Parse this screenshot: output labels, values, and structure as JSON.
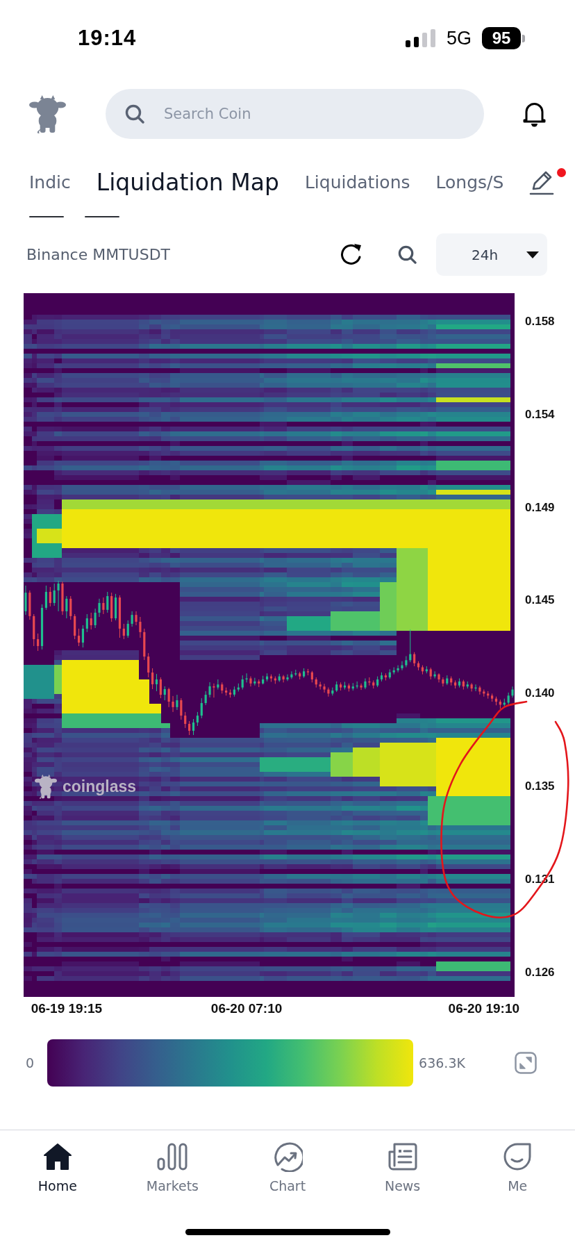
{
  "status_bar": {
    "time": "19:14",
    "network": "5G",
    "battery": "95"
  },
  "search": {
    "placeholder": "Search Coin"
  },
  "tabs": [
    {
      "label": "Indic",
      "selected": false
    },
    {
      "label": "Liquidation Map",
      "selected": true
    },
    {
      "label": "Liquidations",
      "selected": false
    },
    {
      "label": "Longs/S",
      "selected": false
    }
  ],
  "tab_edit": {
    "badge": true
  },
  "toolbar": {
    "pair": "Binance MMTUSDT",
    "interval": "24h"
  },
  "chart": {
    "watermark": "coinglass",
    "chart_data": {
      "type": "candlestick",
      "ylim": [
        0.125,
        0.1598
      ],
      "yticks": [
        {
          "value": 0.1584,
          "label": "0.158"
        },
        {
          "value": 0.1538,
          "label": "0.154"
        },
        {
          "value": 0.1492,
          "label": "0.149"
        },
        {
          "value": 0.1446,
          "label": "0.145"
        },
        {
          "value": 0.14,
          "label": "0.140"
        },
        {
          "value": 0.1354,
          "label": "0.135"
        },
        {
          "value": 0.1308,
          "label": "0.131"
        },
        {
          "value": 0.1262,
          "label": "0.126"
        }
      ],
      "categories": [
        null,
        null,
        null,
        null,
        null,
        null,
        null,
        null,
        null,
        null,
        "06-19 19:15",
        null,
        null,
        null,
        null,
        null,
        null,
        null,
        null,
        null,
        null,
        null,
        null,
        null,
        null,
        null,
        null,
        null,
        null,
        null,
        null,
        null,
        null,
        null,
        null,
        null,
        null,
        null,
        null,
        null,
        null,
        null,
        null,
        null,
        null,
        null,
        null,
        null,
        null,
        null,
        null,
        null,
        null,
        null,
        "06-20 07:10",
        null,
        null,
        null,
        null,
        null,
        null,
        null,
        null,
        null,
        null,
        null,
        null,
        null,
        null,
        null,
        null,
        null,
        null,
        null,
        null,
        null,
        null,
        null,
        null,
        null,
        null,
        null,
        null,
        null,
        null,
        null,
        null,
        null,
        null,
        null,
        null,
        null,
        null,
        null,
        null,
        null,
        null,
        null,
        null,
        null,
        null,
        null,
        null,
        null,
        null,
        null,
        null,
        null,
        null,
        null,
        null,
        null,
        "06-20 19:10",
        null,
        null,
        null,
        null,
        null,
        null,
        null
      ],
      "ohlc": [
        [
          0.14407,
          0.14534,
          0.14389,
          0.14499
        ],
        [
          0.14499,
          0.1451,
          0.14365,
          0.14383
        ],
        [
          0.14383,
          0.14393,
          0.14235,
          0.14269
        ],
        [
          0.14269,
          0.14297,
          0.14211,
          0.14235
        ],
        [
          0.14235,
          0.14441,
          0.14218,
          0.14424
        ],
        [
          0.14424,
          0.14534,
          0.14414,
          0.14503
        ],
        [
          0.14503,
          0.14527,
          0.14431,
          0.14448
        ],
        [
          0.14448,
          0.14544,
          0.14434,
          0.1451
        ],
        [
          0.1451,
          0.14558,
          0.14407,
          0.14544
        ],
        [
          0.14544,
          0.14554,
          0.14389,
          0.14407
        ],
        [
          0.14407,
          0.14482,
          0.14372,
          0.14469
        ],
        [
          0.14469,
          0.14482,
          0.14365,
          0.14383
        ],
        [
          0.14383,
          0.14393,
          0.14269,
          0.14286
        ],
        [
          0.14286,
          0.14321,
          0.14235,
          0.14252
        ],
        [
          0.14252,
          0.14338,
          0.14228,
          0.14321
        ],
        [
          0.14321,
          0.14393,
          0.14304,
          0.14372
        ],
        [
          0.14372,
          0.144,
          0.14317,
          0.14338
        ],
        [
          0.14338,
          0.1442,
          0.14324,
          0.144
        ],
        [
          0.144,
          0.14469,
          0.14379,
          0.14448
        ],
        [
          0.14448,
          0.14475,
          0.14393,
          0.14414
        ],
        [
          0.14414,
          0.14503,
          0.144,
          0.14482
        ],
        [
          0.14482,
          0.14499,
          0.14355,
          0.14372
        ],
        [
          0.14372,
          0.14493,
          0.14362,
          0.14475
        ],
        [
          0.14475,
          0.14486,
          0.14276,
          0.14321
        ],
        [
          0.14321,
          0.14345,
          0.14269,
          0.14286
        ],
        [
          0.14286,
          0.14362,
          0.14276,
          0.14345
        ],
        [
          0.14345,
          0.14407,
          0.14331,
          0.14389
        ],
        [
          0.14389,
          0.14407,
          0.14338,
          0.14355
        ],
        [
          0.14355,
          0.14379,
          0.14276,
          0.14304
        ],
        [
          0.14304,
          0.14321,
          0.14166,
          0.14183
        ],
        [
          0.14183,
          0.142,
          0.1408,
          0.14104
        ],
        [
          0.14104,
          0.14125,
          0.14022,
          0.14046
        ],
        [
          0.14046,
          0.14097,
          0.14012,
          0.1407
        ],
        [
          0.1407,
          0.1408,
          0.13977,
          0.13994
        ],
        [
          0.13994,
          0.14036,
          0.13967,
          0.14022
        ],
        [
          0.14022,
          0.14029,
          0.13933,
          0.1396
        ],
        [
          0.1396,
          0.13988,
          0.13909,
          0.13933
        ],
        [
          0.13933,
          0.13994,
          0.13919,
          0.13967
        ],
        [
          0.13967,
          0.13977,
          0.13871,
          0.13891
        ],
        [
          0.13891,
          0.13909,
          0.1383,
          0.1385
        ],
        [
          0.1385,
          0.13864,
          0.13795,
          0.13816
        ],
        [
          0.13816,
          0.13874,
          0.13795,
          0.13857
        ],
        [
          0.13857,
          0.13909,
          0.1384,
          0.13891
        ],
        [
          0.13891,
          0.13977,
          0.13878,
          0.13953
        ],
        [
          0.13953,
          0.14012,
          0.13943,
          0.13994
        ],
        [
          0.13994,
          0.14056,
          0.13981,
          0.14036
        ],
        [
          0.14036,
          0.1405,
          0.1398,
          0.1403
        ],
        [
          0.1403,
          0.1407,
          0.1402,
          0.14045
        ],
        [
          0.14045,
          0.14055,
          0.14,
          0.14015
        ],
        [
          0.14015,
          0.1403,
          0.1399,
          0.14005
        ],
        [
          0.14005,
          0.1402,
          0.1398,
          0.13995
        ],
        [
          0.13995,
          0.14035,
          0.13985,
          0.1402
        ],
        [
          0.1402,
          0.1405,
          0.1401,
          0.1403
        ],
        [
          0.1403,
          0.1409,
          0.1402,
          0.1407
        ],
        [
          0.1407,
          0.141,
          0.14055,
          0.14075
        ],
        [
          0.14075,
          0.14085,
          0.14035,
          0.1405
        ],
        [
          0.1405,
          0.14078,
          0.1404,
          0.1406
        ],
        [
          0.1406,
          0.1407,
          0.14032,
          0.1405
        ],
        [
          0.1405,
          0.14088,
          0.14045,
          0.1407
        ],
        [
          0.1407,
          0.141,
          0.1406,
          0.14085
        ],
        [
          0.14085,
          0.14095,
          0.14058,
          0.14075
        ],
        [
          0.14075,
          0.14085,
          0.14048,
          0.14065
        ],
        [
          0.14065,
          0.14098,
          0.14058,
          0.14085
        ],
        [
          0.14085,
          0.14092,
          0.14055,
          0.1407
        ],
        [
          0.1407,
          0.14095,
          0.14062,
          0.1408
        ],
        [
          0.1408,
          0.1411,
          0.14072,
          0.14095
        ],
        [
          0.14095,
          0.14118,
          0.14088,
          0.141
        ],
        [
          0.141,
          0.14108,
          0.1407,
          0.14085
        ],
        [
          0.14085,
          0.14125,
          0.14078,
          0.1411
        ],
        [
          0.1411,
          0.14122,
          0.1409,
          0.14105
        ],
        [
          0.14105,
          0.14112,
          0.14055,
          0.1407
        ],
        [
          0.1407,
          0.1408,
          0.1403,
          0.14045
        ],
        [
          0.14045,
          0.14058,
          0.1402,
          0.14035
        ],
        [
          0.14035,
          0.14048,
          0.14005,
          0.1402
        ],
        [
          0.1402,
          0.1403,
          0.13985,
          0.14
        ],
        [
          0.14,
          0.1403,
          0.1399,
          0.14015
        ],
        [
          0.14015,
          0.1406,
          0.14008,
          0.14045
        ],
        [
          0.14045,
          0.14055,
          0.14015,
          0.1403
        ],
        [
          0.1403,
          0.14058,
          0.1402,
          0.1404
        ],
        [
          0.1404,
          0.1405,
          0.1401,
          0.14025
        ],
        [
          0.14025,
          0.14052,
          0.14015,
          0.14035
        ],
        [
          0.14035,
          0.1406,
          0.14025,
          0.1404
        ],
        [
          0.1404,
          0.1405,
          0.14018,
          0.1403
        ],
        [
          0.1403,
          0.14075,
          0.14022,
          0.1406
        ],
        [
          0.1406,
          0.1408,
          0.1404,
          0.14055
        ],
        [
          0.14055,
          0.14065,
          0.14025,
          0.1404
        ],
        [
          0.1404,
          0.14085,
          0.14032,
          0.1407
        ],
        [
          0.1407,
          0.14105,
          0.1406,
          0.1409
        ],
        [
          0.1409,
          0.141,
          0.14065,
          0.1408
        ],
        [
          0.1408,
          0.1412,
          0.14072,
          0.14105
        ],
        [
          0.14105,
          0.1413,
          0.14095,
          0.14115
        ],
        [
          0.14115,
          0.1414,
          0.14105,
          0.14125
        ],
        [
          0.14125,
          0.1416,
          0.14115,
          0.1414
        ],
        [
          0.1414,
          0.14185,
          0.1413,
          0.14165
        ],
        [
          0.14165,
          0.14317,
          0.14155,
          0.14195
        ],
        [
          0.14195,
          0.14205,
          0.14135,
          0.1415
        ],
        [
          0.1415,
          0.1416,
          0.14115,
          0.1413
        ],
        [
          0.1413,
          0.1414,
          0.14095,
          0.1411
        ],
        [
          0.1411,
          0.14135,
          0.141,
          0.1412
        ],
        [
          0.1412,
          0.14128,
          0.1407,
          0.14085
        ],
        [
          0.14085,
          0.1411,
          0.14075,
          0.14095
        ],
        [
          0.14095,
          0.141,
          0.14055,
          0.1407
        ],
        [
          0.1407,
          0.1408,
          0.14035,
          0.1405
        ],
        [
          0.1405,
          0.1409,
          0.14042,
          0.14075
        ],
        [
          0.14075,
          0.14085,
          0.1404,
          0.14055
        ],
        [
          0.14055,
          0.14065,
          0.14025,
          0.1404
        ],
        [
          0.1404,
          0.14075,
          0.1403,
          0.1406
        ],
        [
          0.1406,
          0.14068,
          0.1402,
          0.14035
        ],
        [
          0.14035,
          0.1406,
          0.14025,
          0.14045
        ],
        [
          0.14045,
          0.14052,
          0.1401,
          0.14025
        ],
        [
          0.14025,
          0.14045,
          0.14012,
          0.1403
        ],
        [
          0.1403,
          0.14038,
          0.13995,
          0.1401
        ],
        [
          0.1401,
          0.1402,
          0.13985,
          0.14
        ],
        [
          0.14,
          0.14012,
          0.13975,
          0.1399
        ],
        [
          0.1399,
          0.14,
          0.1396,
          0.13975
        ],
        [
          0.13975,
          0.13985,
          0.13942,
          0.1396
        ],
        [
          0.1396,
          0.1397,
          0.13925,
          0.13945
        ],
        [
          0.13945,
          0.13975,
          0.1393,
          0.13955
        ],
        [
          0.13955,
          0.14005,
          0.13945,
          0.1399
        ],
        [
          0.1399,
          0.14035,
          0.1398,
          0.1402
        ]
      ]
    }
  },
  "legend": {
    "min_label": "0",
    "max_label": "636.3K"
  },
  "nav": [
    {
      "label": "Home",
      "selected": true
    },
    {
      "label": "Markets",
      "selected": false
    },
    {
      "label": "Chart",
      "selected": false
    },
    {
      "label": "News",
      "selected": false
    },
    {
      "label": "Me",
      "selected": false
    }
  ]
}
